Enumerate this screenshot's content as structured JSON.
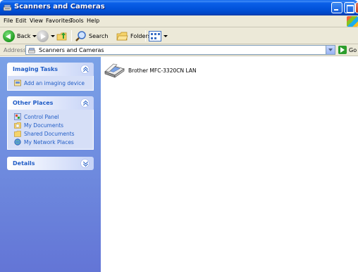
{
  "window": {
    "title": "Scanners and Cameras"
  },
  "menu": {
    "items": [
      {
        "label": "File"
      },
      {
        "label": "Edit"
      },
      {
        "label": "View"
      },
      {
        "label": "Favorites"
      },
      {
        "label": "Tools"
      },
      {
        "label": "Help"
      }
    ]
  },
  "toolbar": {
    "back_label": "Back",
    "search_label": "Search",
    "folders_label": "Folders"
  },
  "address": {
    "label": "Address",
    "value": "Scanners and Cameras",
    "go_label": "Go"
  },
  "taskpane": {
    "imaging_tasks": {
      "title": "Imaging Tasks",
      "items": [
        {
          "label": "Add an imaging device"
        }
      ]
    },
    "other_places": {
      "title": "Other Places",
      "items": [
        {
          "label": "Control Panel"
        },
        {
          "label": "My Documents"
        },
        {
          "label": "Shared Documents"
        },
        {
          "label": "My Network Places"
        }
      ]
    },
    "details": {
      "title": "Details"
    }
  },
  "content": {
    "devices": [
      {
        "label": "Brother MFC-3320CN LAN",
        "icon": "scanner-icon"
      }
    ]
  },
  "colors": {
    "titlebar": "#0a5fe8",
    "taskpane_top": "#7ba2e7",
    "taskpane_bottom": "#6375d6",
    "link": "#215dc6"
  }
}
